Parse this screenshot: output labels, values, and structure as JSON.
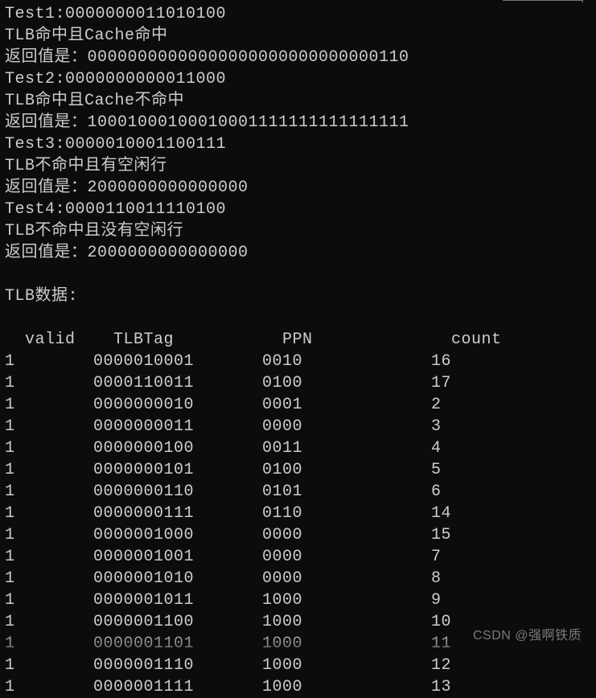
{
  "tests": [
    {
      "label": "Test1:",
      "input": "0000000011010100",
      "status": "TLB命中且Cache命中",
      "return_label": "返回值是：",
      "return_value": "00000000000000000000000000000110"
    },
    {
      "label": "Test2:",
      "input": "0000000000011000",
      "status": "TLB命中且Cache不命中",
      "return_label": "返回值是：",
      "return_value": "10001000100010001111111111111111"
    },
    {
      "label": "Test3:",
      "input": "0000010001100111",
      "status": "TLB不命中且有空闲行",
      "return_label": "返回值是：",
      "return_value": "2000000000000000"
    },
    {
      "label": "Test4:",
      "input": "0000110011110100",
      "status": "TLB不命中且没有空闲行",
      "return_label": "返回值是：",
      "return_value": "2000000000000000"
    }
  ],
  "tlb_section_label": "TLB数据:",
  "tlb_headers": {
    "valid": "valid",
    "tag": "TLBTag",
    "ppn": "PPN",
    "count": "count"
  },
  "tlb_rows": [
    {
      "valid": "1",
      "tag": "0000010001",
      "ppn": "0010",
      "count": "16"
    },
    {
      "valid": "1",
      "tag": "0000110011",
      "ppn": "0100",
      "count": "17"
    },
    {
      "valid": "1",
      "tag": "0000000010",
      "ppn": "0001",
      "count": "2"
    },
    {
      "valid": "1",
      "tag": "0000000011",
      "ppn": "0000",
      "count": "3"
    },
    {
      "valid": "1",
      "tag": "0000000100",
      "ppn": "0011",
      "count": "4"
    },
    {
      "valid": "1",
      "tag": "0000000101",
      "ppn": "0100",
      "count": "5"
    },
    {
      "valid": "1",
      "tag": "0000000110",
      "ppn": "0101",
      "count": "6"
    },
    {
      "valid": "1",
      "tag": "0000000111",
      "ppn": "0110",
      "count": "14"
    },
    {
      "valid": "1",
      "tag": "0000001000",
      "ppn": "0000",
      "count": "15"
    },
    {
      "valid": "1",
      "tag": "0000001001",
      "ppn": "0000",
      "count": "7"
    },
    {
      "valid": "1",
      "tag": "0000001010",
      "ppn": "0000",
      "count": "8"
    },
    {
      "valid": "1",
      "tag": "0000001011",
      "ppn": "1000",
      "count": "9"
    },
    {
      "valid": "1",
      "tag": "0000001100",
      "ppn": "1000",
      "count": "10"
    },
    {
      "valid": "1",
      "tag": "0000001101",
      "ppn": "1000",
      "count": "11"
    },
    {
      "valid": "1",
      "tag": "0000001110",
      "ppn": "1000",
      "count": "12"
    },
    {
      "valid": "1",
      "tag": "0000001111",
      "ppn": "1000",
      "count": "13"
    }
  ],
  "watermark": "CSDN @强啊铁质"
}
